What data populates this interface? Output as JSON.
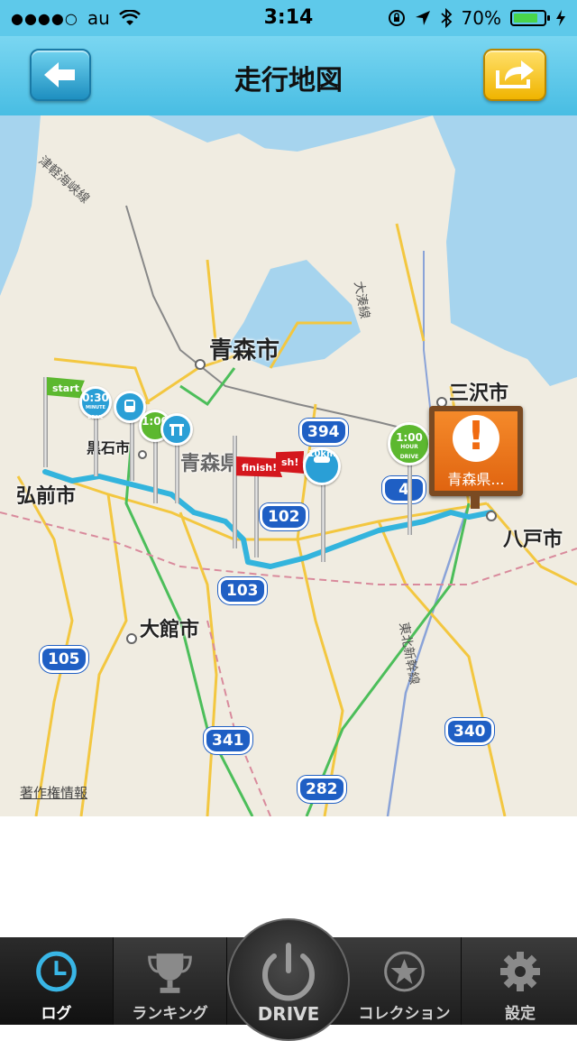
{
  "status_bar": {
    "carrier": "au",
    "signal": "●●●●○",
    "time": "3:14",
    "battery_pct": "70%"
  },
  "nav": {
    "title": "走行地図"
  },
  "map": {
    "cities": {
      "aomori_shi": "青森市",
      "misawa_shi": "三沢市",
      "hirosaki_shi": "弘前市",
      "hachinohe_shi": "八戸市",
      "odate_shi": "大館市",
      "kuroishi_shi": "黒石市",
      "aomori_ken": "青森県"
    },
    "rail_labels": {
      "tsugaru_kaikyo": "津軽海峡線",
      "tohoku_shinkansen": "東北新幹線",
      "ominato": "大湊線"
    },
    "routes": {
      "r394": "394",
      "r4": "4",
      "r102": "102",
      "r103": "103",
      "r105": "105",
      "r341": "341",
      "r282": "282",
      "r340": "340"
    },
    "markers": {
      "start_flag": "start",
      "finish_flag_1": "finish!",
      "finish_flag_2": "sh!",
      "badge_30min_value": "0:30",
      "badge_30min_unit": "MINUTE DRIVE",
      "badge_1hour_value": "1:00",
      "badge_1hour_unit": "HOUR DRIVE",
      "badge_10km_value": "10km",
      "badge_10km_unit": "DRIVE"
    },
    "sign_label": "青森県...",
    "sign_symbol": "!",
    "copyright": "著作権情報",
    "route_color": "#33b4dd"
  },
  "tabs": [
    {
      "label": "ログ",
      "icon": "clock-icon",
      "active": true
    },
    {
      "label": "ランキング",
      "icon": "trophy-icon",
      "active": false
    },
    {
      "label": "DRIVE",
      "icon": "power-icon",
      "active": false
    },
    {
      "label": "コレクション",
      "icon": "star-icon",
      "active": false
    },
    {
      "label": "設定",
      "icon": "gear-icon",
      "active": false
    }
  ]
}
